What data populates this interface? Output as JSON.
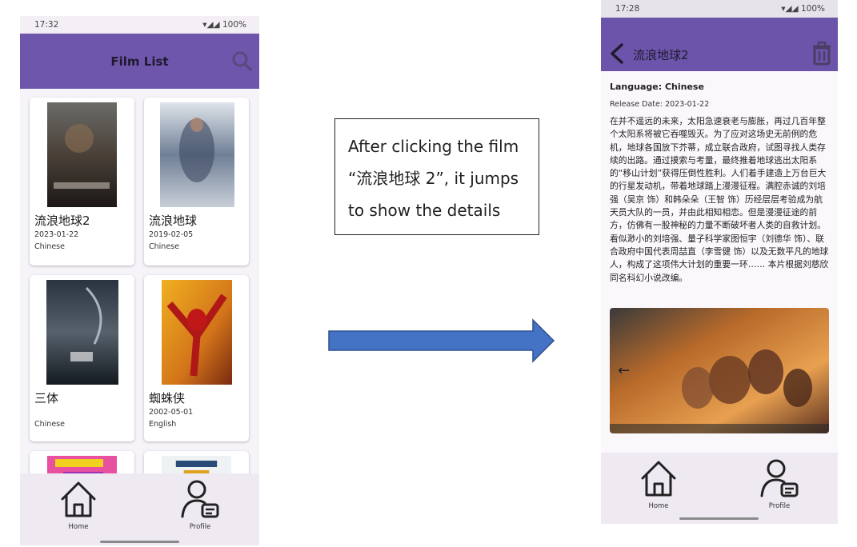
{
  "left_phone": {
    "status": {
      "time": "17:32",
      "battery": "100%"
    },
    "appbar": {
      "title": "Film List",
      "search_icon": "search-icon"
    },
    "films": [
      {
        "title": "流浪地球2",
        "date": "2023-01-22",
        "language": "Chinese"
      },
      {
        "title": "流浪地球",
        "date": "2019-02-05",
        "language": "Chinese"
      },
      {
        "title": "三体",
        "date": "",
        "language": "Chinese"
      },
      {
        "title": "蜘蛛侠",
        "date": "2002-05-01",
        "language": "English"
      },
      {
        "title": "",
        "date": "",
        "language": ""
      },
      {
        "title": "",
        "date": "",
        "language": ""
      }
    ],
    "nav": {
      "home": "Home",
      "profile": "Profile"
    }
  },
  "annotation": {
    "line1": "After clicking the film",
    "line2": "“流浪地球 2”, it jumps",
    "line3": "to show the details"
  },
  "right_phone": {
    "status": {
      "time": "17:28",
      "battery": "100%"
    },
    "appbar": {
      "title": "流浪地球2",
      "back_icon": "back-arrow-icon",
      "delete_icon": "trash-icon"
    },
    "language": "Language: Chinese",
    "release_date": "Release Date: 2023-01-22",
    "description": "在并不遥远的未来，太阳急速衰老与膨胀，再过几百年整个太阳系将被它吞噬毁灭。为了应对这场史无前例的危机，地球各国放下芥蒂，成立联合政府，试图寻找人类存续的出路。通过摸索与考量，最终推着地球逃出太阳系的“移山计划”获得压倒性胜利。人们着手建造上万台巨大的行星发动机，带着地球踏上漫漫征程。满腔赤诚的刘培强（吴京 饰）和韩朵朵（王智 饰）历经层层考验成为航天员大队的一员，并由此相知相恋。但是漫漫征途的前方，仿佛有一股神秘的力量不断破坏者人类的自救计划。看似渺小的刘培强、量子科学家图恒宇（刘德华 饰）、联合政府中国代表周喆直（李雪健 饰）以及无数平凡的地球人，构成了这项伟大计划的重要一环…… 本片根据刘慈欣同名科幻小说改编。",
    "nav": {
      "home": "Home",
      "profile": "Profile"
    }
  }
}
